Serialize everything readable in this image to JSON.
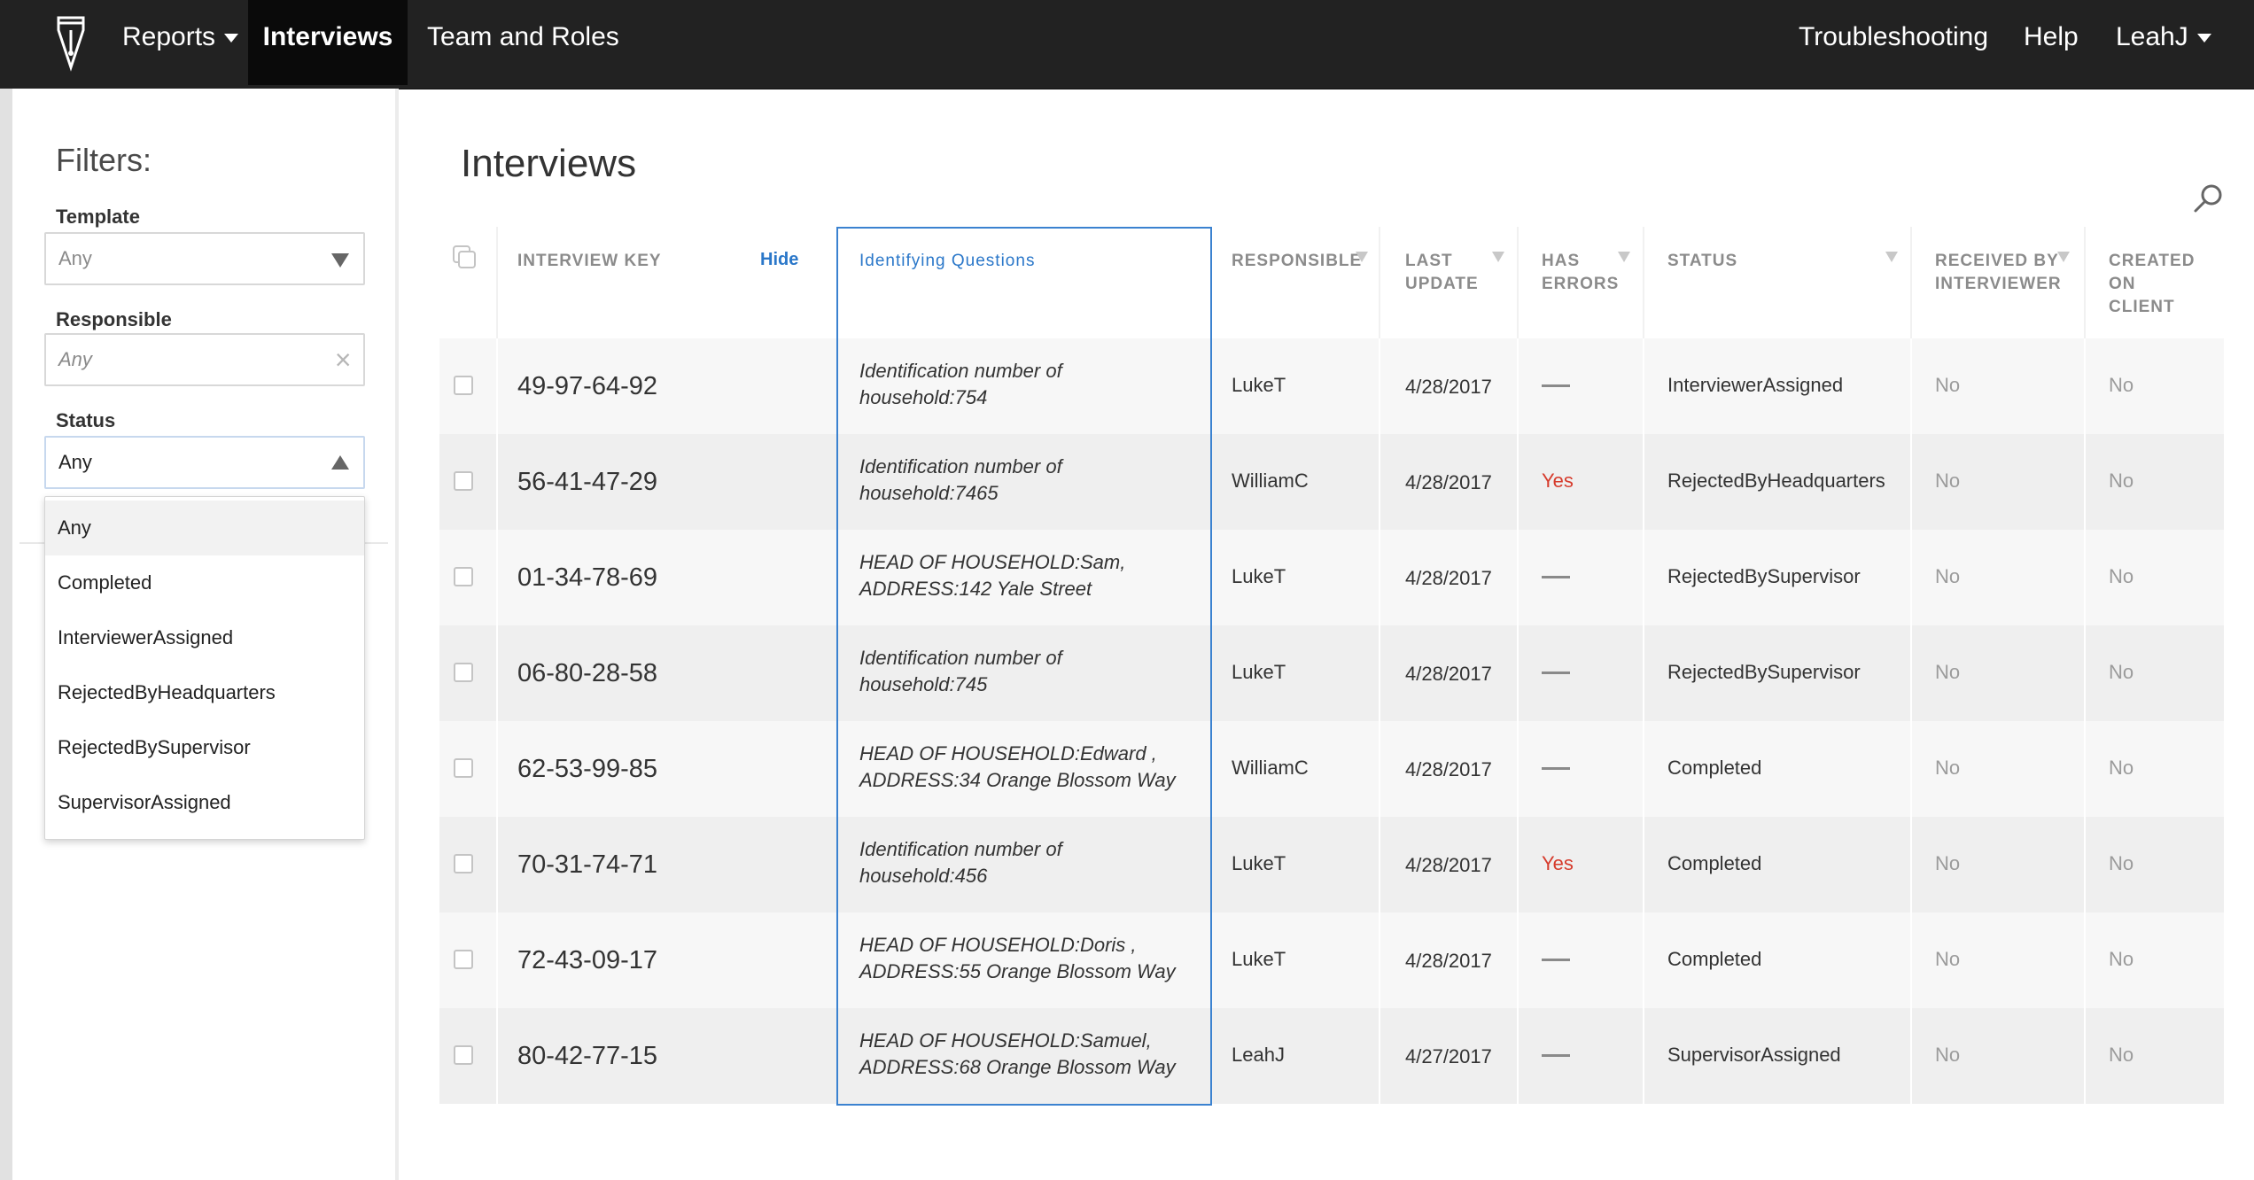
{
  "nav": {
    "left": [
      {
        "label": "Reports",
        "has_caret": true
      },
      {
        "label": "Interviews",
        "active": true
      },
      {
        "label": "Team and Roles"
      }
    ],
    "right": [
      {
        "label": "Troubleshooting"
      },
      {
        "label": "Help"
      },
      {
        "label": "LeahJ",
        "has_caret": true
      }
    ]
  },
  "sidebar": {
    "title": "Filters:",
    "template": {
      "label": "Template",
      "value": "Any"
    },
    "responsible": {
      "label": "Responsible",
      "placeholder": "Any"
    },
    "status": {
      "label": "Status",
      "value": "Any",
      "options": [
        "Any",
        "Completed",
        "InterviewerAssigned",
        "RejectedByHeadquarters",
        "RejectedBySupervisor",
        "SupervisorAssigned"
      ]
    }
  },
  "main": {
    "title": "Interviews",
    "columns": {
      "interview_key": "INTERVIEW KEY",
      "hide": "Hide",
      "identifying_questions": "Identifying Questions",
      "responsible": "RESPONSIBLE",
      "last_update": [
        "LAST",
        "UPDATE"
      ],
      "has_errors": [
        "HAS",
        "ERRORS"
      ],
      "status": "STATUS",
      "received_by_interviewer": [
        "RECEIVED BY",
        "INTERVIEWER"
      ],
      "created_on_client": [
        "CREATED",
        "ON",
        "CLIENT"
      ]
    },
    "rows": [
      {
        "key": "49-97-64-92",
        "iq": [
          "Identification number of",
          "household:754"
        ],
        "responsible": "LukeT",
        "last_update": "4/28/2017",
        "has_errors": "—",
        "status": "InterviewerAssigned",
        "received": "No",
        "created": "No"
      },
      {
        "key": "56-41-47-29",
        "iq": [
          "Identification number of",
          "household:7465"
        ],
        "responsible": "WilliamC",
        "last_update": "4/28/2017",
        "has_errors": "Yes",
        "status": "RejectedByHeadquarters",
        "received": "No",
        "created": "No"
      },
      {
        "key": "01-34-78-69",
        "iq": [
          "HEAD OF HOUSEHOLD:Sam,",
          "ADDRESS:142 Yale Street"
        ],
        "responsible": "LukeT",
        "last_update": "4/28/2017",
        "has_errors": "—",
        "status": "RejectedBySupervisor",
        "received": "No",
        "created": "No"
      },
      {
        "key": "06-80-28-58",
        "iq": [
          "Identification number of",
          "household:745"
        ],
        "responsible": "LukeT",
        "last_update": "4/28/2017",
        "has_errors": "—",
        "status": "RejectedBySupervisor",
        "received": "No",
        "created": "No"
      },
      {
        "key": "62-53-99-85",
        "iq": [
          "HEAD OF HOUSEHOLD:Edward ,",
          "ADDRESS:34 Orange Blossom Way"
        ],
        "responsible": "WilliamC",
        "last_update": "4/28/2017",
        "has_errors": "—",
        "status": "Completed",
        "received": "No",
        "created": "No"
      },
      {
        "key": "70-31-74-71",
        "iq": [
          "Identification number of",
          "household:456"
        ],
        "responsible": "LukeT",
        "last_update": "4/28/2017",
        "has_errors": "Yes",
        "status": "Completed",
        "received": "No",
        "created": "No"
      },
      {
        "key": "72-43-09-17",
        "iq": [
          "HEAD OF HOUSEHOLD:Doris ,",
          "ADDRESS:55 Orange Blossom Way"
        ],
        "responsible": "LukeT",
        "last_update": "4/28/2017",
        "has_errors": "—",
        "status": "Completed",
        "received": "No",
        "created": "No"
      },
      {
        "key": "80-42-77-15",
        "iq": [
          "HEAD OF HOUSEHOLD:Samuel,",
          "ADDRESS:68 Orange Blossom Way"
        ],
        "responsible": "LeahJ",
        "last_update": "4/27/2017",
        "has_errors": "—",
        "status": "SupervisorAssigned",
        "received": "No",
        "created": "No"
      }
    ]
  },
  "colors": {
    "nav_bg": "#222222",
    "nav_active_bg": "#0a0a0a",
    "accent_blue": "#2a77c9",
    "error_red": "#d63b2c"
  }
}
